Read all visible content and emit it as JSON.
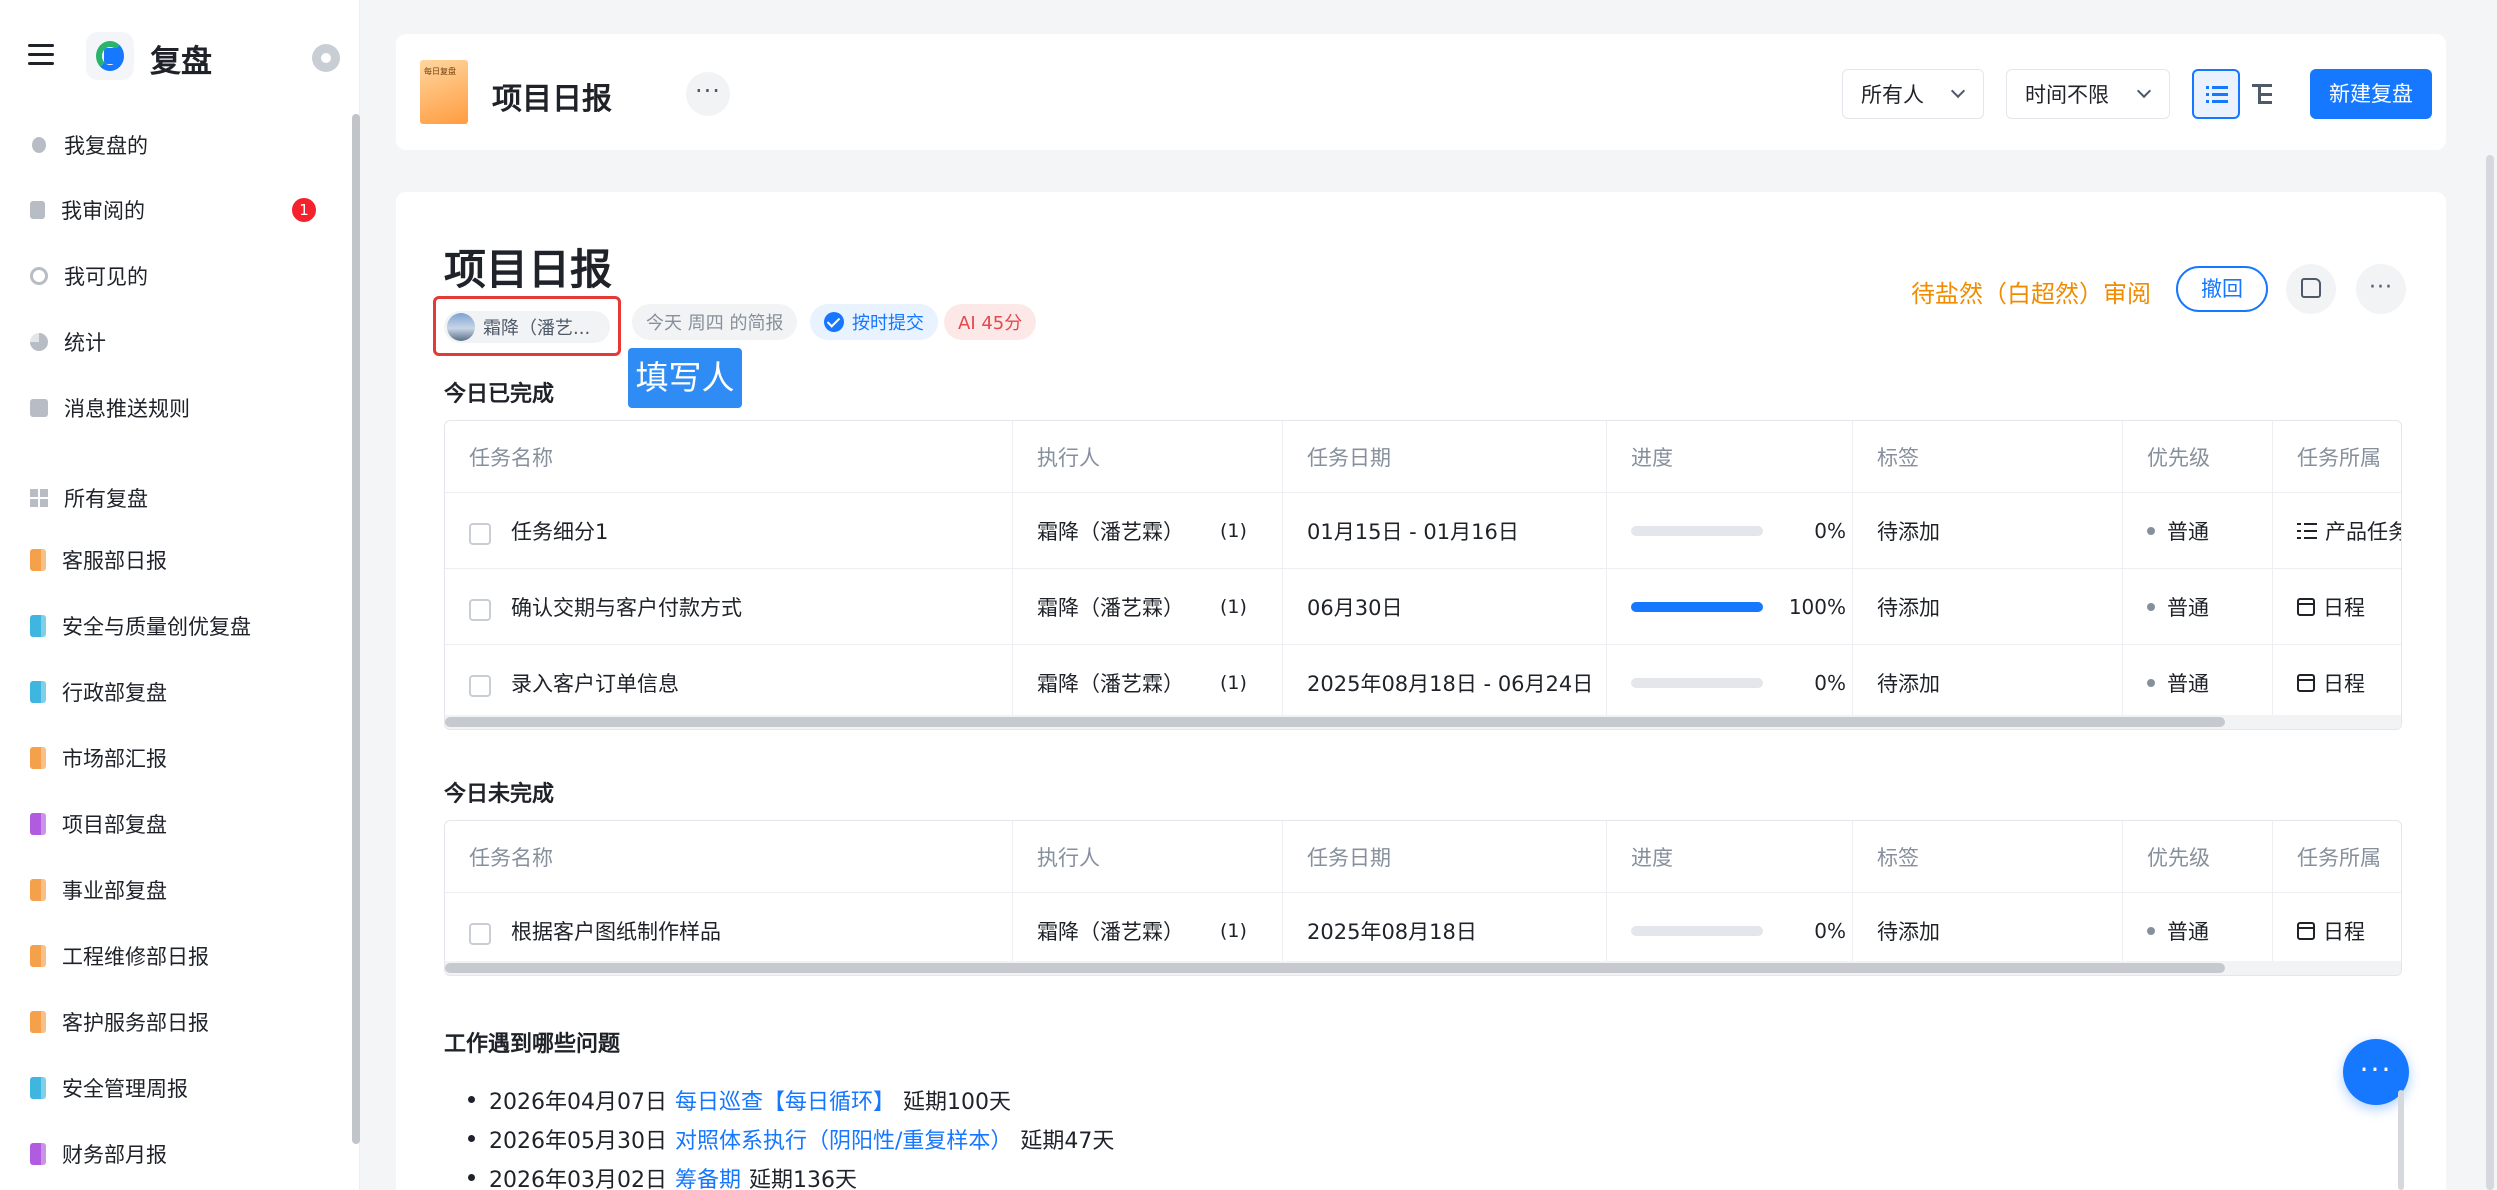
{
  "sidebar": {
    "app_name": "复盘",
    "items": [
      {
        "label": "我复盘的",
        "icon": "user-icon"
      },
      {
        "label": "我审阅的",
        "icon": "clipboard-icon",
        "badge": "1"
      },
      {
        "label": "我可见的",
        "icon": "eye-icon"
      },
      {
        "label": "统计",
        "icon": "pie-chart-icon"
      },
      {
        "label": "消息推送规则",
        "icon": "message-icon"
      }
    ],
    "all_label": "所有复盘",
    "templates": [
      {
        "label": "客服部日报",
        "color": "#f5a04a"
      },
      {
        "label": "安全与质量创优复盘",
        "color": "#3fb6e0"
      },
      {
        "label": "行政部复盘",
        "color": "#3fb6e0"
      },
      {
        "label": "市场部汇报",
        "color": "#f5a04a"
      },
      {
        "label": "项目部复盘",
        "color": "#b15ce0"
      },
      {
        "label": "事业部复盘",
        "color": "#f5a04a"
      },
      {
        "label": "工程维修部日报",
        "color": "#f5a04a"
      },
      {
        "label": "客护服务部日报",
        "color": "#f5a04a"
      },
      {
        "label": "安全管理周报",
        "color": "#3fb6e0"
      },
      {
        "label": "财务部月报",
        "color": "#b15ce0"
      }
    ]
  },
  "header": {
    "thumb_text": "每日复盘",
    "title": "项目日报",
    "more": "···",
    "filter_person": "所有人",
    "filter_time": "时间不限",
    "new_button": "新建复盘"
  },
  "report": {
    "title": "项目日报",
    "author": "霜降（潘艺...",
    "date_chip": "今天 周四 的简报",
    "status_chip": "按时提交",
    "ai_chip": "AI 45分",
    "tooltip": "填写人",
    "reviewer": "待盐然（白超然）审阅",
    "revoke": "撤回",
    "more": "···"
  },
  "columns": [
    "任务名称",
    "执行人",
    "任务日期",
    "进度",
    "标签",
    "优先级",
    "任务所属"
  ],
  "completed": {
    "title": "今日已完成",
    "rows": [
      {
        "name": "任务细分1",
        "executor": "霜降（潘艺霖）",
        "count": "(1)",
        "date": "01月15日 - 01月16日",
        "progress": 0,
        "progress_text": "0%",
        "tag": "待添加",
        "priority": "普通",
        "belong": "产品任务",
        "belong_icon": "list-icon"
      },
      {
        "name": "确认交期与客户付款方式",
        "executor": "霜降（潘艺霖）",
        "count": "(1)",
        "date": "06月30日",
        "progress": 100,
        "progress_text": "100%",
        "tag": "待添加",
        "priority": "普通",
        "belong": "日程",
        "belong_icon": "calendar-icon"
      },
      {
        "name": "录入客户订单信息",
        "executor": "霜降（潘艺霖）",
        "count": "(1)",
        "date": "2025年08月18日 - 06月24日",
        "progress": 0,
        "progress_text": "0%",
        "tag": "待添加",
        "priority": "普通",
        "belong": "日程",
        "belong_icon": "calendar-icon"
      }
    ]
  },
  "incomplete": {
    "title": "今日未完成",
    "rows": [
      {
        "name": "根据客户图纸制作样品",
        "executor": "霜降（潘艺霖）",
        "count": "(1)",
        "date": "2025年08月18日",
        "progress": 0,
        "progress_text": "0%",
        "tag": "待添加",
        "priority": "普通",
        "belong": "日程",
        "belong_icon": "calendar-icon"
      }
    ]
  },
  "issues": {
    "title": "工作遇到哪些问题",
    "items": [
      {
        "date": "2026年04月07日",
        "link": "每日巡查【每日循环】",
        "delay": "延期100天"
      },
      {
        "date": "2026年05月30日",
        "link": "对照体系执行（阴阳性/重复样本）",
        "delay": "延期47天"
      },
      {
        "date": "2026年03月02日",
        "link": "筹备期",
        "delay": "延期136天"
      }
    ]
  },
  "fab": "···",
  "colors": {
    "accent": "#1677ff",
    "danger": "#f5222d",
    "warning": "#f08c00"
  }
}
